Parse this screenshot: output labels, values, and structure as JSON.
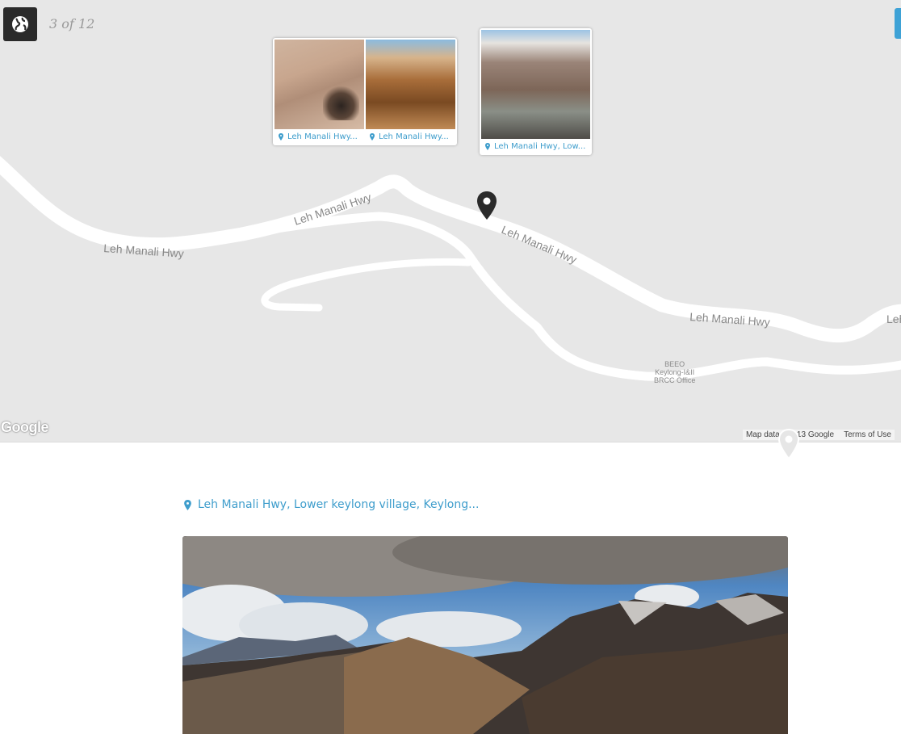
{
  "header": {
    "counter": "3 of 12",
    "globe_icon": "globe-icon"
  },
  "map": {
    "road_labels": [
      "Leh Manali Hwy",
      "Leh Manali Hwy",
      "Leh Manali Hwy",
      "Leh Manali Hwy",
      "Leh"
    ],
    "place_label": "BEEO\nKeylong-I&II\nBRCC Office",
    "google_logo": "Google",
    "attribution": "Map data ©2013 Google",
    "terms": "Terms of Use",
    "colors": {
      "background": "#e7e7e7",
      "road": "#ffffff",
      "accent": "#3e9dcc",
      "marker": "#2b2b2b"
    }
  },
  "photo_clusters": [
    {
      "captions": [
        "Leh Manali Hwy...",
        "Leh Manali Hwy..."
      ]
    },
    {
      "captions": [
        "Leh Manali Hwy, Low..."
      ]
    }
  ],
  "detail": {
    "location": "Leh Manali Hwy, Lower keylong village, Keylong..."
  }
}
